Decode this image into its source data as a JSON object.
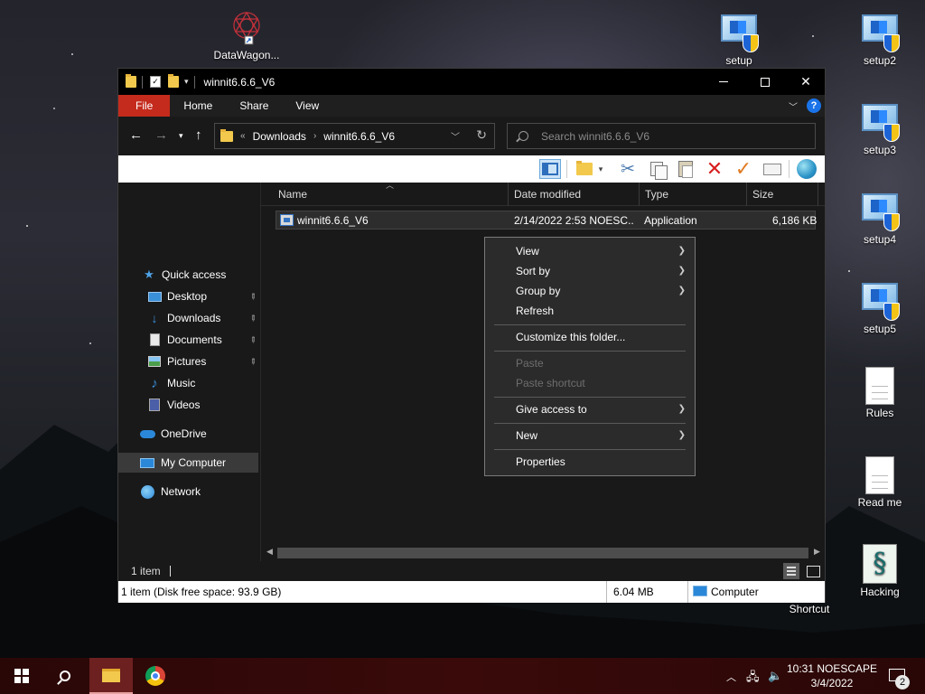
{
  "desktop": {
    "icons": {
      "datawagon": "DataWagon...",
      "setup": "setup",
      "setup2": "setup2",
      "setup3": "setup3",
      "setup4": "setup4",
      "setup5": "setup5",
      "rules": "Rules",
      "readme": "Read me",
      "hacking": "Hacking",
      "shortcut": "Shortcut"
    }
  },
  "window": {
    "title": "winnit6.6.6_V6",
    "ribbon_tabs": [
      "File",
      "Home",
      "Share",
      "View"
    ],
    "address": {
      "breadcrumb_root": "«",
      "crumbs": [
        "Downloads",
        "winnit6.6.6_V6"
      ]
    },
    "search": {
      "placeholder": "Search winnit6.6.6_V6"
    },
    "nav": {
      "quick_access": "Quick access",
      "desktop": "Desktop",
      "downloads": "Downloads",
      "documents": "Documents",
      "pictures": "Pictures",
      "music": "Music",
      "videos": "Videos",
      "onedrive": "OneDrive",
      "my_computer": "My Computer",
      "network": "Network"
    },
    "columns": {
      "name": "Name",
      "date": "Date modified",
      "type": "Type",
      "size": "Size"
    },
    "files": [
      {
        "name": "winnit6.6.6_V6",
        "date": "2/14/2022 2:53 NOESC...",
        "type": "Application",
        "size": "6,186 KB"
      }
    ],
    "status": {
      "count": "1 item"
    },
    "info": {
      "left": "1 item (Disk free space: 93.9 GB)",
      "size": "6.04 MB",
      "location": "Computer"
    }
  },
  "context_menu": {
    "view": "View",
    "sort_by": "Sort by",
    "group_by": "Group by",
    "refresh": "Refresh",
    "customize": "Customize this folder...",
    "paste": "Paste",
    "paste_shortcut": "Paste shortcut",
    "give_access": "Give access to",
    "new": "New",
    "properties": "Properties"
  },
  "taskbar": {
    "time": "10:31 NOESCAPE",
    "date": "3/4/2022",
    "notifications": "2"
  },
  "colors": {
    "file_tab": "#c42b1c",
    "taskbar": "#3a0a0a",
    "window_bg": "#191919"
  }
}
